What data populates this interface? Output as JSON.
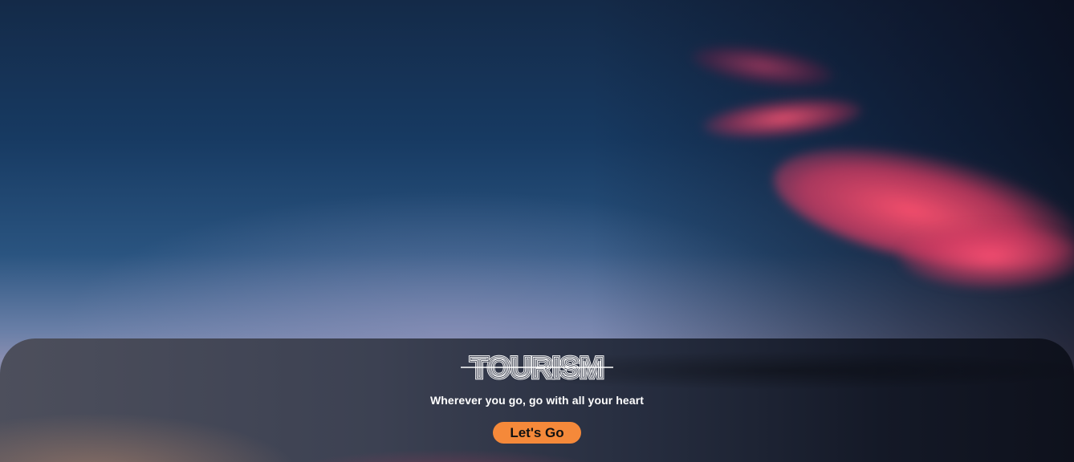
{
  "hero": {
    "logo_text": "TOURISM",
    "tagline": "Wherever you go, go with all your heart",
    "cta_label": "Let's Go"
  },
  "colors": {
    "cta_background": "#f5893a",
    "cta_text": "#111111",
    "text": "#ffffff",
    "panel": "#2c3243"
  },
  "icons": {
    "logo": "outlined-striped-wordmark"
  }
}
